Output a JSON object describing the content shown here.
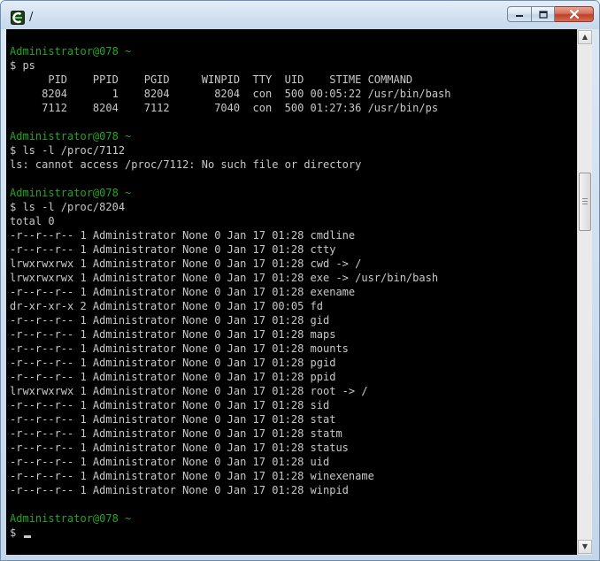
{
  "window": {
    "title": "/"
  },
  "terminal": {
    "prompt_user": "Administrator@078",
    "lines": [
      {
        "kind": "prompt",
        "text": "Administrator@078 ~"
      },
      {
        "kind": "out",
        "text": "$ ps"
      },
      {
        "kind": "out",
        "text": "      PID    PPID    PGID     WINPID  TTY  UID    STIME COMMAND"
      },
      {
        "kind": "out",
        "text": "     8204       1    8204       8204  con  500 00:05:22 /usr/bin/bash"
      },
      {
        "kind": "out",
        "text": "     7112    8204    7112       7040  con  500 01:27:36 /usr/bin/ps"
      },
      {
        "kind": "blank",
        "text": ""
      },
      {
        "kind": "prompt",
        "text": "Administrator@078 ~"
      },
      {
        "kind": "out",
        "text": "$ ls -l /proc/7112"
      },
      {
        "kind": "out",
        "text": "ls: cannot access /proc/7112: No such file or directory"
      },
      {
        "kind": "blank",
        "text": ""
      },
      {
        "kind": "prompt",
        "text": "Administrator@078 ~"
      },
      {
        "kind": "out",
        "text": "$ ls -l /proc/8204"
      },
      {
        "kind": "out",
        "text": "total 0"
      },
      {
        "kind": "out",
        "text": "-r--r--r-- 1 Administrator None 0 Jan 17 01:28 cmdline"
      },
      {
        "kind": "out",
        "text": "-r--r--r-- 1 Administrator None 0 Jan 17 01:28 ctty"
      },
      {
        "kind": "out",
        "text": "lrwxrwxrwx 1 Administrator None 0 Jan 17 01:28 cwd -> /"
      },
      {
        "kind": "out",
        "text": "lrwxrwxrwx 1 Administrator None 0 Jan 17 01:28 exe -> /usr/bin/bash"
      },
      {
        "kind": "out",
        "text": "-r--r--r-- 1 Administrator None 0 Jan 17 01:28 exename"
      },
      {
        "kind": "out",
        "text": "dr-xr-xr-x 2 Administrator None 0 Jan 17 00:05 fd"
      },
      {
        "kind": "out",
        "text": "-r--r--r-- 1 Administrator None 0 Jan 17 01:28 gid"
      },
      {
        "kind": "out",
        "text": "-r--r--r-- 1 Administrator None 0 Jan 17 01:28 maps"
      },
      {
        "kind": "out",
        "text": "-r--r--r-- 1 Administrator None 0 Jan 17 01:28 mounts"
      },
      {
        "kind": "out",
        "text": "-r--r--r-- 1 Administrator None 0 Jan 17 01:28 pgid"
      },
      {
        "kind": "out",
        "text": "-r--r--r-- 1 Administrator None 0 Jan 17 01:28 ppid"
      },
      {
        "kind": "out",
        "text": "lrwxrwxrwx 1 Administrator None 0 Jan 17 01:28 root -> /"
      },
      {
        "kind": "out",
        "text": "-r--r--r-- 1 Administrator None 0 Jan 17 01:28 sid"
      },
      {
        "kind": "out",
        "text": "-r--r--r-- 1 Administrator None 0 Jan 17 01:28 stat"
      },
      {
        "kind": "out",
        "text": "-r--r--r-- 1 Administrator None 0 Jan 17 01:28 statm"
      },
      {
        "kind": "out",
        "text": "-r--r--r-- 1 Administrator None 0 Jan 17 01:28 status"
      },
      {
        "kind": "out",
        "text": "-r--r--r-- 1 Administrator None 0 Jan 17 01:28 uid"
      },
      {
        "kind": "out",
        "text": "-r--r--r-- 1 Administrator None 0 Jan 17 01:28 winexename"
      },
      {
        "kind": "out",
        "text": "-r--r--r-- 1 Administrator None 0 Jan 17 01:28 winpid"
      },
      {
        "kind": "blank",
        "text": ""
      },
      {
        "kind": "prompt",
        "text": "Administrator@078 ~"
      },
      {
        "kind": "input",
        "text": "$ "
      }
    ]
  },
  "colors": {
    "terminal_bg": "#000000",
    "text": "#c8c8c8",
    "prompt": "#1fa81f"
  },
  "icons": {
    "app": "cygwin-icon",
    "minimize": "minimize-icon",
    "maximize": "maximize-icon",
    "close": "close-icon",
    "scroll_up": "arrow-up-icon",
    "scroll_down": "arrow-down-icon"
  }
}
